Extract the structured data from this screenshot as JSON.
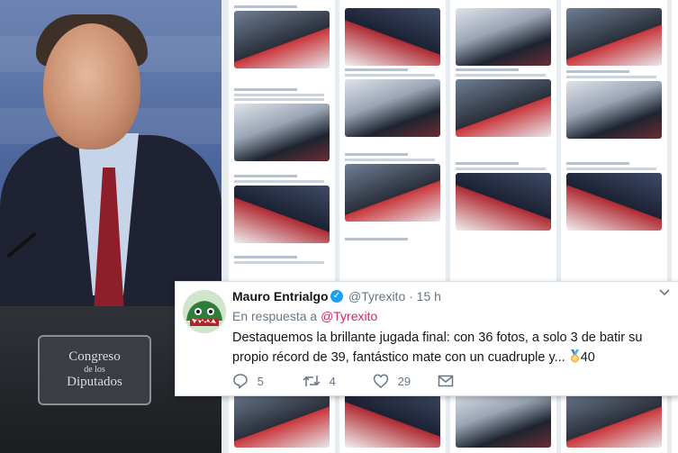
{
  "photo": {
    "plaque_line1": "Congreso",
    "plaque_line2": "de los",
    "plaque_line3": "Diputados"
  },
  "tweet": {
    "name": "Mauro Entrialgo",
    "handle": "@Tyrexito",
    "time": "· 15 h",
    "reply_prefix": "En respuesta a",
    "reply_to": "@Tyrexito",
    "text": "Destaquemos la brillante jugada final: con 36 fotos, a solo 3 de batir su propio récord de 39, fantástico mate con un cuadruple y...",
    "medal_count": "40",
    "replies": "5",
    "retweets": "4",
    "likes": "29"
  },
  "icons": [
    "verified-badge-icon",
    "chevron-down-icon",
    "reply-icon",
    "retweet-icon",
    "like-icon",
    "message-icon",
    "medal-icon"
  ],
  "colors": {
    "link_red": "#e0245e",
    "verified_blue": "#1da1f2",
    "muted": "#657786"
  }
}
